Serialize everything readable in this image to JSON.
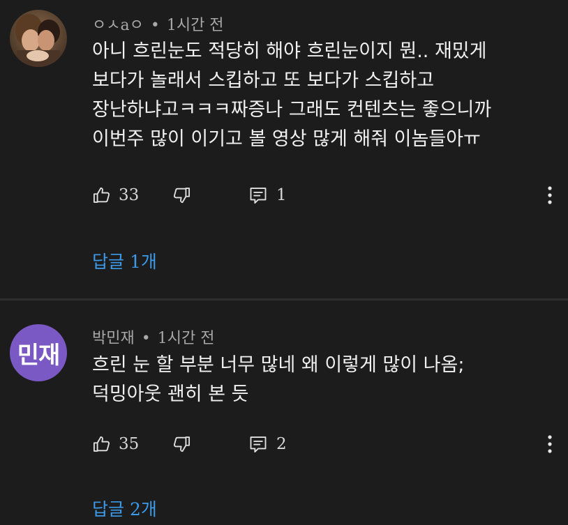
{
  "comments": [
    {
      "author": "ㅇㅅaㅇ",
      "separator": "•",
      "time": "1시간 전",
      "lines": [
        "아니 흐린눈도 적당히 해야 흐린눈이지 뭔.. 재밌게",
        "보다가 놀래서 스킵하고 또 보다가 스킵하고",
        "장난하냐고ㅋㅋㅋ짜증나 그래도 컨텐츠는 좋으니까",
        "이번주 많이 이기고 볼 영상 많게 해줘 이놈들아ㅠ"
      ],
      "likes": "33",
      "reply_count": "1",
      "replies_label": "답글 1개",
      "avatar_icon": "user-photo-avatar"
    },
    {
      "author": "박민재",
      "separator": "•",
      "time": "1시간 전",
      "avatar_text": "민재",
      "avatar_color": "#7b59c4",
      "lines": [
        "흐린 눈 할 부분 너무 많네 왜 이렇게 많이 나옴;",
        "덕밍아웃 괜히 본 듯"
      ],
      "likes": "35",
      "reply_count": "2",
      "replies_label": "답글 2개"
    }
  ],
  "theme": {
    "background": "#1c1c1c",
    "link_color": "#3d9ae8",
    "meta_color": "#a8a8a8"
  }
}
